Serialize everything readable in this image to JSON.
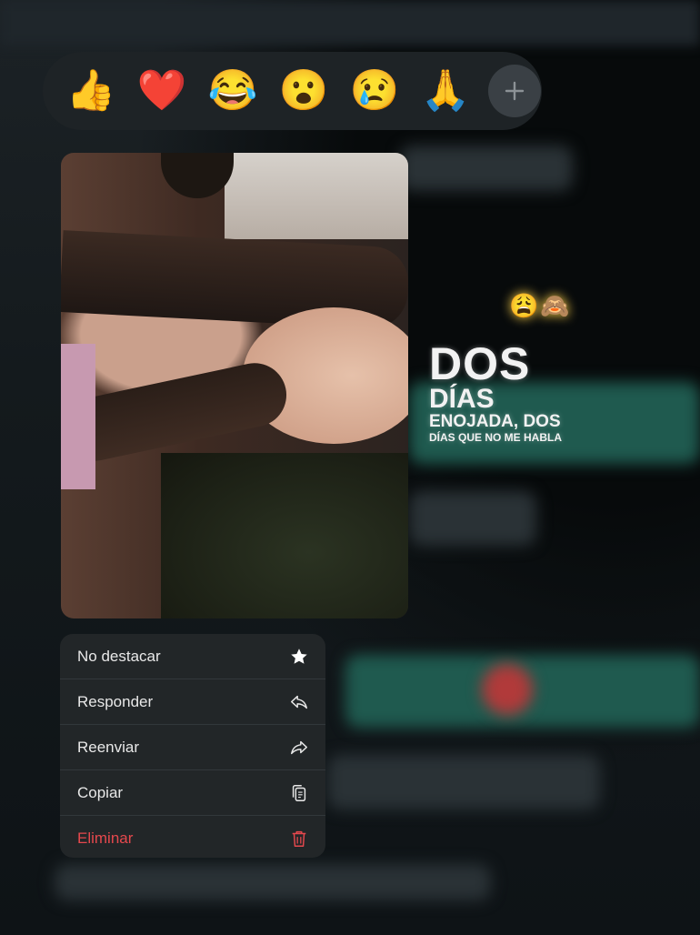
{
  "reactions": {
    "emojis": [
      "👍",
      "❤️",
      "😂",
      "😮",
      "😢",
      "🙏"
    ],
    "more_icon": "plus-icon"
  },
  "status_overlay": {
    "emojis": [
      "😩",
      "🙈"
    ],
    "line1": "DOS",
    "line2": "DÍAS",
    "line3": "ENOJADA, DOS",
    "line4": "DÍAS QUE NO ME HABLA"
  },
  "menu": {
    "items": [
      {
        "label": "No destacar",
        "icon": "star-icon"
      },
      {
        "label": "Responder",
        "icon": "reply-icon"
      },
      {
        "label": "Reenviar",
        "icon": "forward-icon"
      },
      {
        "label": "Copiar",
        "icon": "copy-icon"
      },
      {
        "label": "Eliminar",
        "icon": "trash-icon"
      }
    ]
  },
  "colors": {
    "danger": "#e5484d",
    "menu_bg": "#222628",
    "reaction_bar_bg": "#1e2326"
  }
}
